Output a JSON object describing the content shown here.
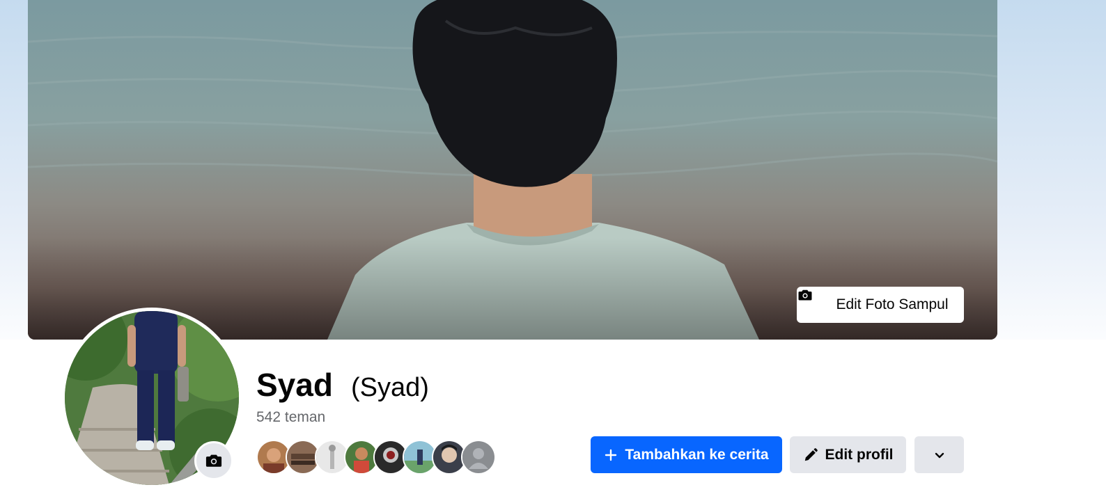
{
  "profile": {
    "name": "Syad",
    "alternate_name": "(Syad)",
    "friends_count": "542 teman"
  },
  "cover": {
    "edit_button_label": "Edit Foto Sampul",
    "icon": "camera-icon"
  },
  "avatar": {
    "camera_icon": "camera-icon"
  },
  "friend_avatars": [
    {
      "color": "#b07a4e"
    },
    {
      "color": "#8a6a55"
    },
    {
      "color": "#d8d8d8"
    },
    {
      "color": "#c46a3a"
    },
    {
      "color": "#2a2a2a"
    },
    {
      "color": "#6aa6b8"
    },
    {
      "color": "#3b3f4a"
    },
    {
      "color": "#8a8d91"
    }
  ],
  "actions": {
    "add_story_label": "Tambahkan ke cerita",
    "add_story_icon": "plus-icon",
    "edit_profile_label": "Edit profil",
    "edit_profile_icon": "pencil-icon",
    "more_icon": "chevron-down-icon"
  },
  "colors": {
    "primary": "#0866ff",
    "secondary_bg": "#e4e6eb",
    "muted_text": "#65676b"
  }
}
